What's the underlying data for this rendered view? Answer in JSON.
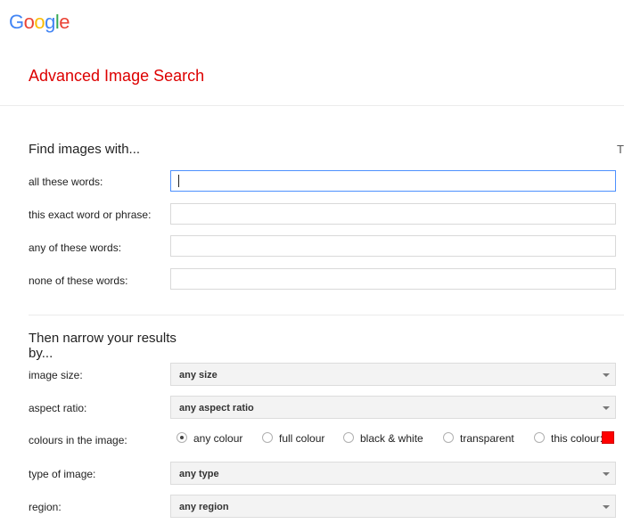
{
  "brand": {
    "letters": [
      {
        "char": "G",
        "color": "#4285f4"
      },
      {
        "char": "o",
        "color": "#ea4335"
      },
      {
        "char": "o",
        "color": "#fbbc05"
      },
      {
        "char": "g",
        "color": "#4285f4"
      },
      {
        "char": "l",
        "color": "#34a853"
      },
      {
        "char": "e",
        "color": "#ea4335"
      }
    ]
  },
  "page_title": "Advanced Image Search",
  "find_section": {
    "heading": "Find images with...",
    "fields": [
      {
        "label": "all these words:",
        "value": "",
        "focused": true
      },
      {
        "label": "this exact word or phrase:",
        "value": ""
      },
      {
        "label": "any of these words:",
        "value": ""
      },
      {
        "label": "none of these words:",
        "value": ""
      }
    ],
    "corner_glyph": "T"
  },
  "narrow_section": {
    "heading_line1": "Then narrow your results",
    "heading_line2": "by...",
    "image_size": {
      "label": "image size:",
      "selected": "any size"
    },
    "aspect_ratio": {
      "label": "aspect ratio:",
      "selected": "any aspect ratio"
    },
    "colours": {
      "label": "colours in the image:",
      "options": [
        "any colour",
        "full colour",
        "black & white",
        "transparent",
        "this colour:"
      ],
      "selected_index": 0,
      "swatch_color": "#ff0000"
    },
    "type_of_image": {
      "label": "type of image:",
      "selected": "any type"
    },
    "region": {
      "label": "region:",
      "selected": "any region"
    }
  }
}
